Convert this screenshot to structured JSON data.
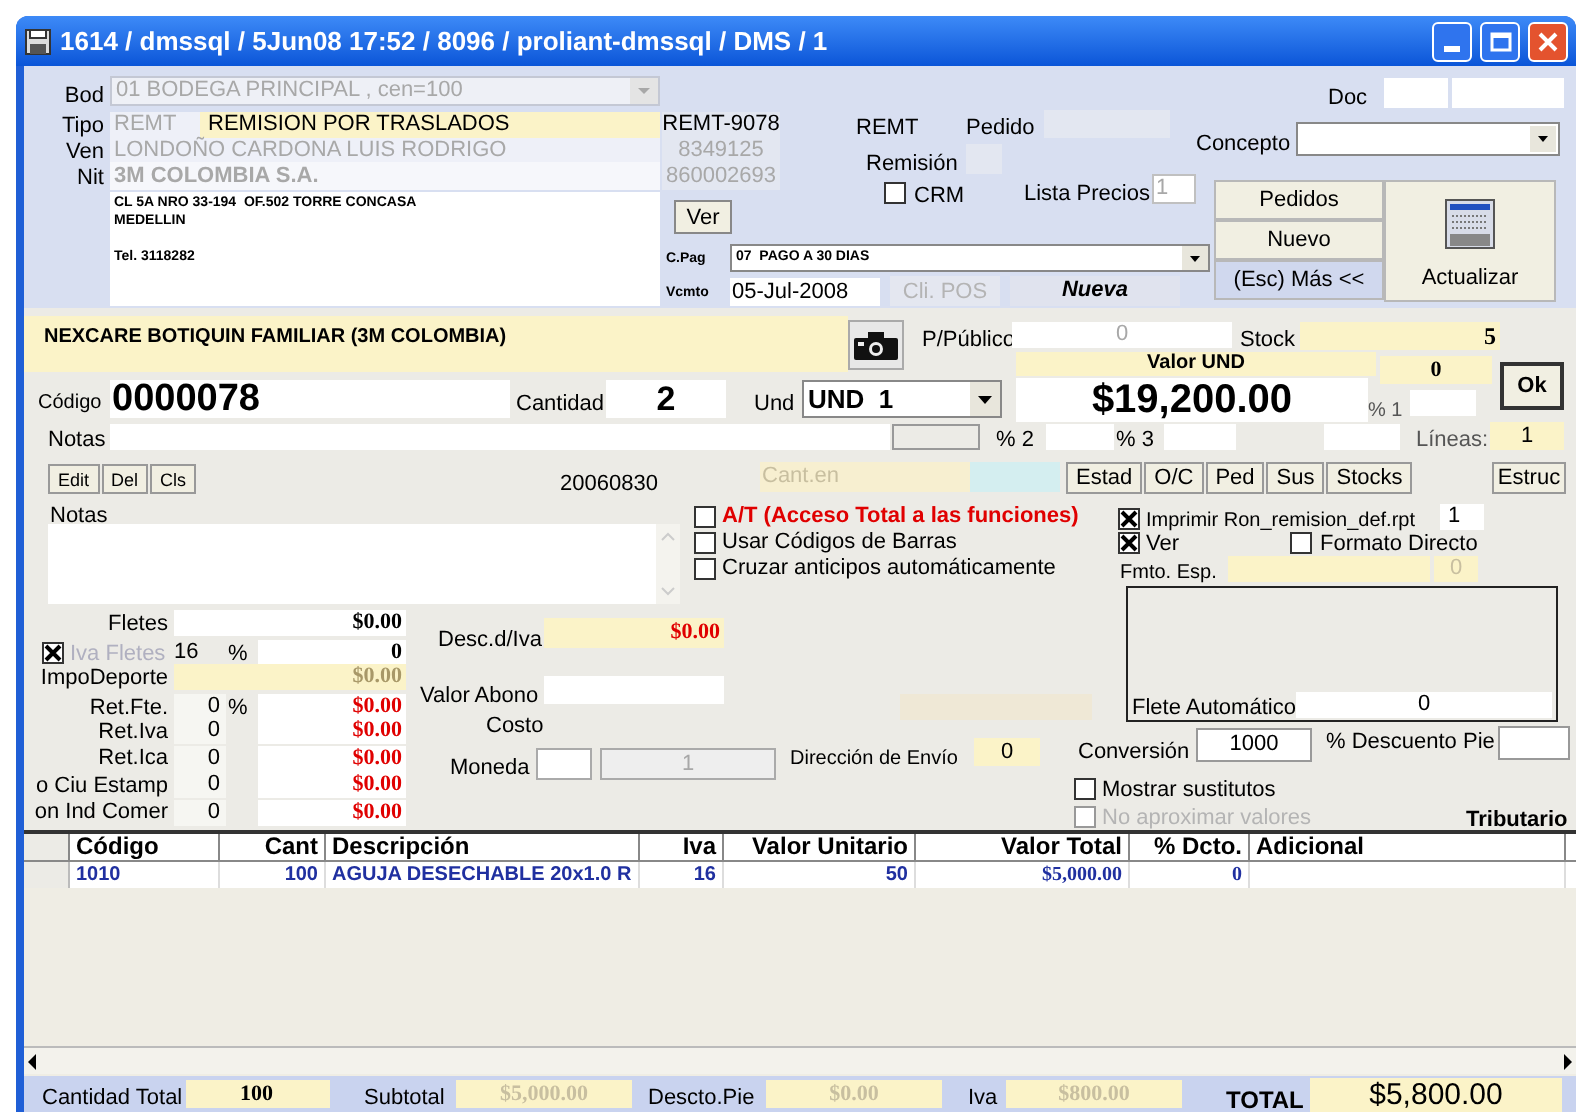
{
  "window": {
    "title": "1614 / dmssql / 5Jun08 17:52 / 8096 / proliant-dmssql / DMS / 1"
  },
  "header": {
    "bod_label": "Bod",
    "bodega": "01  BODEGA PRINCIPAL , cen=100",
    "tipo_label": "Tipo",
    "tipo_code": "REMT",
    "tipo_name": "REMISION POR TRASLADOS",
    "ven_label": "Ven",
    "vendedor": "LONDOÑO CARDONA LUIS RODRIGO",
    "nit_label": "Nit",
    "cliente": "3M COLOMBIA S.A.",
    "address_lines": [
      "CL 5A NRO 33-194  OF.502 TORRE CONCASA",
      "MEDELLIN",
      "Tel. 3118282"
    ],
    "documento": "REMT-9078",
    "ven_code": "8349125",
    "nit": "860002693",
    "tipo_short": "REMT",
    "pedido_label": "Pedido",
    "remision_label": "Remisión",
    "crm": {
      "label": "CRM",
      "checked": false
    },
    "lista_precios_label": "Lista Precios",
    "lista_precios": "1",
    "doc_label": "Doc",
    "concepto_label": "Concepto",
    "ver_button": "Ver",
    "cpag_label": "C.Pag",
    "cpag": "07  PAGO A 30 DIAS",
    "vcmto_label": "Vcmto",
    "vcmto": "05-Jul-2008",
    "cli_pos": {
      "label": "Cli. POS",
      "disabled": true
    },
    "estado": "Nueva",
    "buttons": [
      "Pedidos",
      "Nuevo",
      "(Esc) Más <<"
    ],
    "actualizar": "Actualizar"
  },
  "product": {
    "descripcion": "NEXCARE BOTIQUIN FAMILIAR (3M COLOMBIA)",
    "ppublico_label": "P/Público",
    "ppublico": "0",
    "stock_label": "Stock",
    "stock": "5",
    "valor_und_label": "Valor UND",
    "valor_und_extra": "0",
    "ok": "Ok",
    "codigo_label": "Código",
    "codigo": "0000078",
    "cantidad_label": "Cantidad",
    "cantidad": "2",
    "und_label": "Und",
    "und": "UND  1",
    "valor": "$19,200.00",
    "p1_label": "% 1",
    "notas_label": "Notas",
    "p2_label": "% 2",
    "p3_label": "% 3",
    "lineas_label": "Líneas:",
    "lineas": "1",
    "edit_buttons": [
      "Edit",
      "Del",
      "Cls"
    ],
    "fecha": "20060830",
    "cant_en": "Cant.en",
    "actions": [
      "Estad",
      "O/C",
      "Ped",
      "Sus",
      "Stocks"
    ],
    "estruc": "Estruc",
    "notas2_label": "Notas"
  },
  "flags": [
    {
      "label": "A/T (Acceso Total a las funciones)",
      "checked": false,
      "kind": "warning"
    },
    {
      "label": "Usar Códigos de Barras",
      "checked": false,
      "kind": "normal"
    },
    {
      "label": "Cruzar anticipos automáticamente",
      "checked": false,
      "kind": "normal"
    }
  ],
  "print": {
    "imprimir": {
      "label": "Imprimir Ron_remision_def.rpt",
      "checked": true
    },
    "copias": "1",
    "ver": {
      "label": "Ver",
      "checked": true
    },
    "formato_directo": {
      "label": "Formato Directo",
      "checked": false
    },
    "fmto_esp_label": "Fmto. Esp.",
    "fmto_esp_num": "0",
    "flete_auto_label": "Flete Automático",
    "flete_auto": "0"
  },
  "charges": [
    {
      "kind": "plain",
      "label": "Fletes",
      "amount": "$0.00"
    },
    {
      "kind": "check",
      "label": "Iva Fletes",
      "checked": true,
      "rate": "16",
      "unit": "%",
      "amount": "0"
    },
    {
      "kind": "muted",
      "label": "ImpoDeporte",
      "amount": "$0.00"
    },
    {
      "kind": "ret",
      "label": "Ret.Fte.",
      "rate": "0",
      "unit": "%",
      "amount": "$0.00"
    },
    {
      "kind": "ret",
      "label": "Ret.Iva",
      "rate": "0",
      "amount": "$0.00"
    },
    {
      "kind": "ret",
      "label": "Ret.Ica",
      "rate": "0",
      "amount": "$0.00"
    },
    {
      "kind": "ret",
      "label": "o Ciu Estamp",
      "rate": "0",
      "amount": "$0.00"
    },
    {
      "kind": "ret",
      "label": "on Ind Comer",
      "rate": "0",
      "amount": "$0.00"
    }
  ],
  "middle": {
    "desc_iva_label": "Desc.d/Iva",
    "desc_iva": "$0.00",
    "valor_abono_label": "Valor Abono",
    "costo_label": "Costo",
    "moneda_label": "Moneda",
    "moneda_factor": "1",
    "direccion_label": "Dirección de Envío",
    "direccion": "0",
    "conversion_label": "Conversión",
    "conversion": "1000",
    "descuento_pie_label": "% Descuento Pie",
    "mostrar": {
      "label": "Mostrar sustitutos",
      "checked": false,
      "disabled": false
    },
    "no_aprox": {
      "label": "No aproximar valores",
      "checked": false,
      "disabled": true
    },
    "tributario": "Tributario"
  },
  "table": {
    "columns": [
      "Código",
      "Cant",
      "Descripción",
      "Iva",
      "Valor Unitario",
      "Valor Total",
      "% Dcto.",
      "Adicional"
    ],
    "rows": [
      {
        "cells": [
          "1010",
          "100",
          "AGUJA DESECHABLE 20x1.0 R",
          "16",
          "50",
          "$5,000.00",
          "0",
          ""
        ]
      }
    ]
  },
  "totals": {
    "cantidad_label": "Cantidad Total",
    "cantidad": "100",
    "subtotal_label": "Subtotal",
    "subtotal": "$5,000.00",
    "descto_label": "Descto.Pie",
    "descto": "$0.00",
    "iva_label": "Iva",
    "iva": "$800.00",
    "total_label": "TOTAL",
    "total": "$5,800.00"
  }
}
